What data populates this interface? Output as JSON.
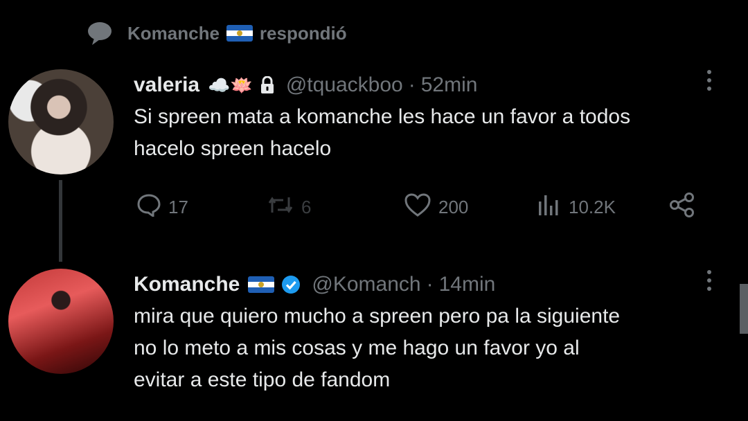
{
  "reply_context": {
    "name": "Komanche",
    "flag": "🇸🇻",
    "action": "respondió",
    "icon": "chat-bubble-icon"
  },
  "tweets": [
    {
      "name": "valeria",
      "emoji": "☁️🪷",
      "lock": true,
      "handle": "@tquackboo",
      "separator": "·",
      "time": "52min",
      "text_lines": [
        "Si spreen mata a komanche les hace un favor a todos",
        "hacelo spreen hacelo"
      ],
      "stats": {
        "replies": "17",
        "retweets": "6",
        "likes": "200",
        "views": "10.2K"
      }
    },
    {
      "name": "Komanche",
      "flag": "🇸🇻",
      "verified": true,
      "handle": "@Komanch",
      "separator": "·",
      "time": "14min",
      "text_lines": [
        "mira que quiero mucho a spreen pero pa la siguiente",
        "no lo meto a mis cosas y me hago un favor yo al",
        "evitar a este tipo de fandom"
      ]
    }
  ],
  "colors": {
    "background": "#000000",
    "text": "#e7e9ea",
    "muted": "#71767b",
    "verified": "#1d9bf0",
    "flag_blue": "#1f5fb4"
  }
}
